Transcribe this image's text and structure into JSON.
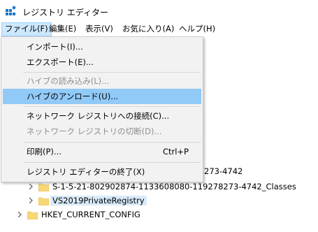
{
  "window": {
    "title": "レジストリ エディター"
  },
  "menubar": {
    "items": [
      {
        "label": "ファイル(F)"
      },
      {
        "label": "編集(E)"
      },
      {
        "label": "表示(V)"
      },
      {
        "label": "お気に入り(A)"
      },
      {
        "label": "ヘルプ(H)"
      }
    ]
  },
  "file_menu": {
    "items": [
      {
        "label": "インポート(I)...",
        "shortcut": "",
        "disabled": false,
        "highlighted": false
      },
      {
        "label": "エクスポート(E)...",
        "shortcut": "",
        "disabled": false,
        "highlighted": false
      },
      {
        "label": "ハイブの読み込み(L)...",
        "shortcut": "",
        "disabled": true,
        "highlighted": false
      },
      {
        "label": "ハイブのアンロード(U)...",
        "shortcut": "",
        "disabled": false,
        "highlighted": true
      },
      {
        "label": "ネットワーク レジストリへの接続(C)...",
        "shortcut": "",
        "disabled": false,
        "highlighted": false
      },
      {
        "label": "ネットワーク レジストリの切断(D)...",
        "shortcut": "",
        "disabled": true,
        "highlighted": false
      },
      {
        "label": "印刷(P)...",
        "shortcut": "Ctrl+P",
        "disabled": false,
        "highlighted": false
      },
      {
        "label": "レジストリ エディターの終了(X)",
        "shortcut": "",
        "disabled": false,
        "highlighted": false
      }
    ]
  },
  "tree": {
    "visible_fragment": "273-4742",
    "rows": [
      {
        "label": "S-1-5-21-802902874-1133608080-119278273-4742_Classes",
        "selected": false
      },
      {
        "label": "VS2019PrivateRegistry",
        "selected": true
      },
      {
        "label": "HKEY_CURRENT_CONFIG",
        "selected": false
      }
    ]
  },
  "colors": {
    "highlight": "#91c9f7",
    "menu_active": "#cce8ff",
    "selected_node": "#d9ebf9",
    "folder": "#f8d775",
    "disabled_text": "#8d8d8d"
  },
  "icons": {
    "app": "registry-editor-icon",
    "folder": "folder-icon",
    "expander": "chevron-right-icon"
  }
}
